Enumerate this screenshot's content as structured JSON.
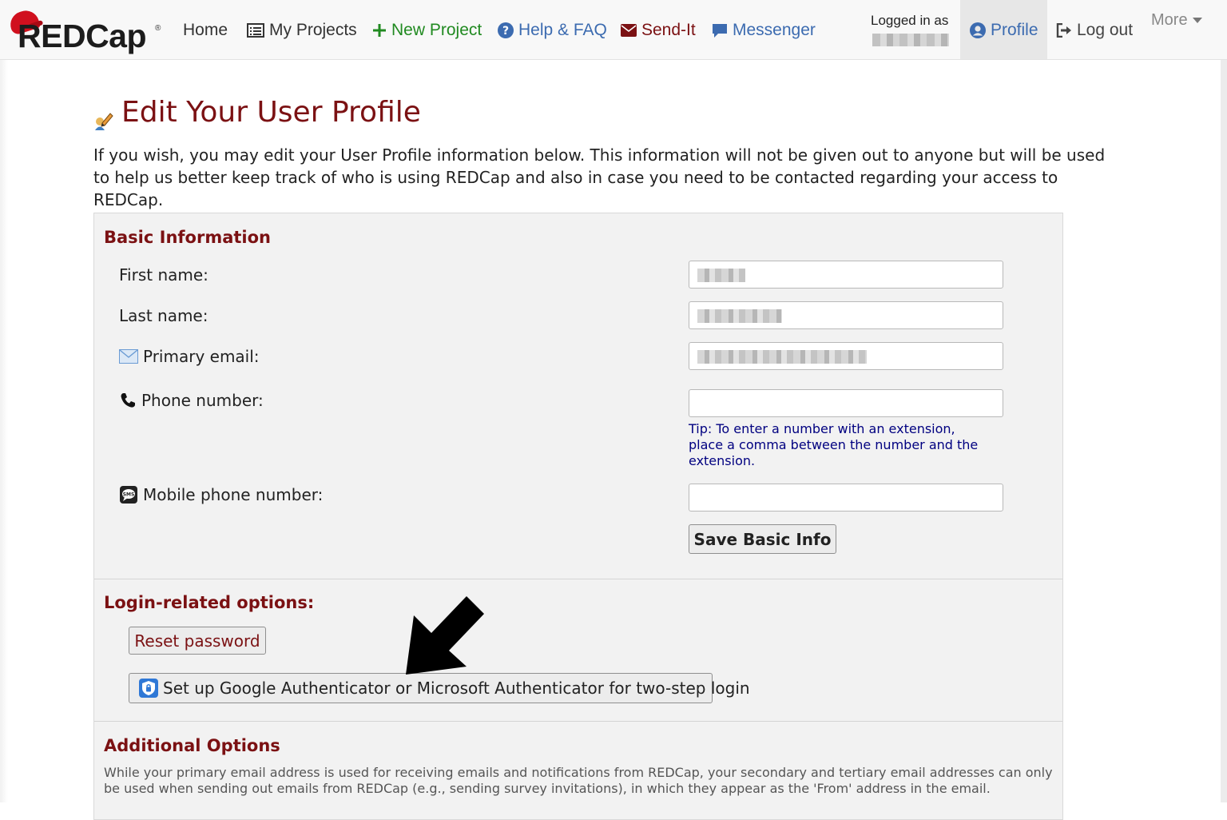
{
  "navbar": {
    "logo_text": "REDCap",
    "logo_reg": "®",
    "home": "Home",
    "my_projects": "My Projects",
    "new_project": "New Project",
    "help_faq": "Help & FAQ",
    "send_it": "Send-It",
    "messenger": "Messenger",
    "logged_in_as": "Logged in as",
    "profile": "Profile",
    "log_out": "Log out",
    "more": "More"
  },
  "page": {
    "title": "Edit Your User Profile",
    "intro": "If you wish, you may edit your User Profile information below. This information will not be given out to anyone but will be used to help us better keep track of who is using REDCap and also in case you need to be contacted regarding your access to REDCap."
  },
  "basic_info": {
    "heading": "Basic Information",
    "first_name_label": "First name:",
    "last_name_label": "Last name:",
    "primary_email_label": "Primary email:",
    "phone_label": "Phone number:",
    "phone_tip": "Tip: To enter a number with an extension, place a comma between the number and the extension.",
    "mobile_label": "Mobile phone number:",
    "save_button": "Save Basic Info"
  },
  "login_options": {
    "heading": "Login-related options:",
    "reset_password": "Reset password",
    "authenticator_setup": "Set up Google Authenticator or Microsoft Authenticator for two-step login"
  },
  "additional_options": {
    "heading": "Additional Options",
    "note": "While your primary email address is used for receiving emails and notifications from REDCap, your secondary and tertiary email addresses can only be used when sending out emails from REDCap (e.g., sending survey invitations), in which they appear as the 'From' address in the email."
  },
  "colors": {
    "brand_red": "#7b1113",
    "link_blue": "#3c6bb0",
    "new_project_green": "#218a21",
    "tip_navy": "#000080"
  },
  "icons": [
    "list-icon",
    "plus-icon",
    "question-circle-icon",
    "envelope-icon",
    "chat-icon",
    "user-circle-icon",
    "sign-out-icon",
    "caret-down-icon",
    "pencil-user-icon",
    "mail-icon",
    "phone-icon",
    "sms-icon",
    "lock-shield-icon",
    "arrow-pointer"
  ]
}
